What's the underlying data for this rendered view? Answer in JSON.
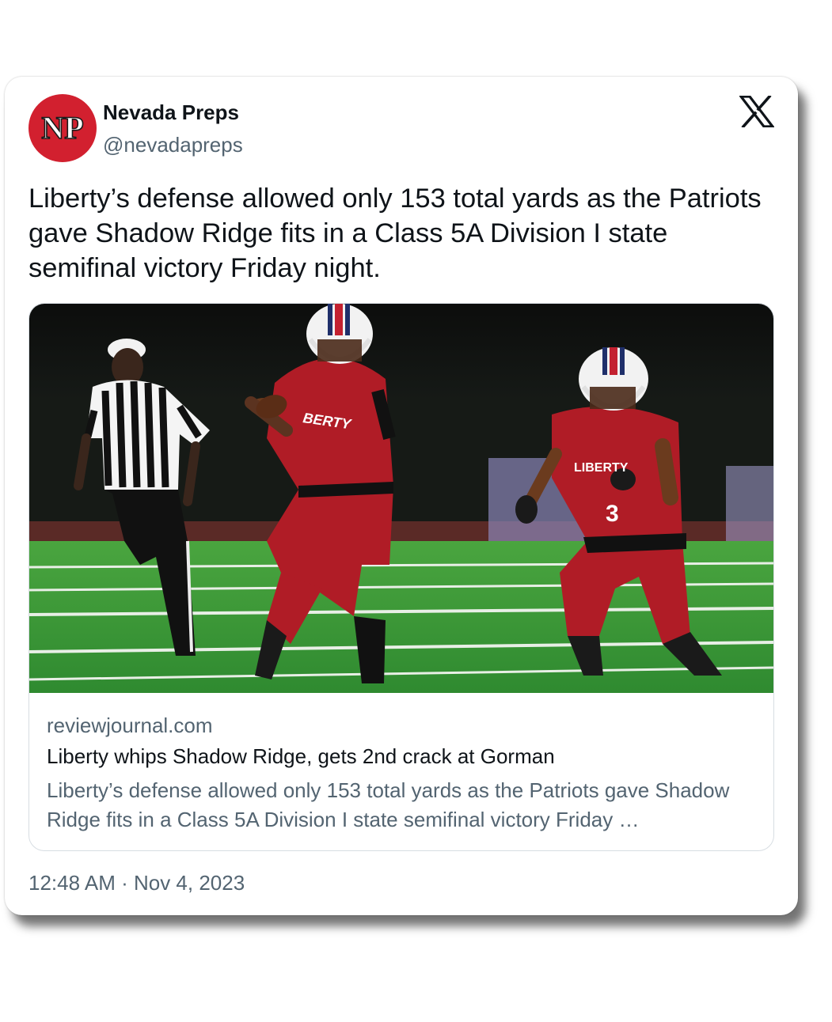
{
  "author": {
    "name": "Nevada Preps",
    "handle": "@nevadapreps",
    "avatar_text": "NP"
  },
  "tweet": {
    "text": "Liberty’s defense allowed only 153 total yards as the Patriots gave Shadow Ridge fits in a Class 5A Division I state semifinal victory Friday night."
  },
  "link_card": {
    "domain": "reviewjournal.com",
    "title": "Liberty whips Shadow Ridge, gets 2nd crack at Gorman",
    "description": "Liberty’s defense allowed only 153 total yards as the Patriots gave Shadow Ridge fits in a Class 5A Division I state semifinal victory Friday …",
    "image": {
      "jersey_text_1": "BERTY",
      "jersey_text_2": "LIBERTY",
      "jersey_number": "3"
    }
  },
  "timestamp": "12:48 AM · Nov 4, 2023",
  "colors": {
    "brand_red": "#d2202f",
    "text_primary": "#0f1419",
    "text_secondary": "#536471",
    "jersey_red": "#b01c26",
    "field_green": "#3f9a3a"
  },
  "icons": {
    "platform": "x-logo-icon"
  }
}
